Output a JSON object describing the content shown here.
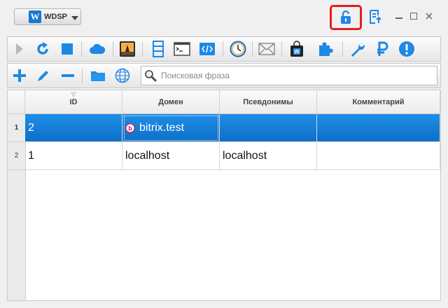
{
  "app": {
    "logo_letter": "W",
    "name": "WDSP"
  },
  "search": {
    "placeholder": "Поисковая фраза",
    "value": ""
  },
  "table": {
    "columns": [
      "ID",
      "Домен",
      "Псевдонимы",
      "Комментарий"
    ],
    "rows": [
      {
        "num": "1",
        "id": "2",
        "domain": "bitrix.test",
        "aliases": "",
        "comment": "",
        "selected": true
      },
      {
        "num": "2",
        "id": "1",
        "domain": "localhost",
        "aliases": "localhost",
        "comment": "",
        "selected": false
      }
    ]
  },
  "colors": {
    "accent": "#1e88e5",
    "selection": "#1275d3",
    "highlight_border": "#e02020"
  }
}
